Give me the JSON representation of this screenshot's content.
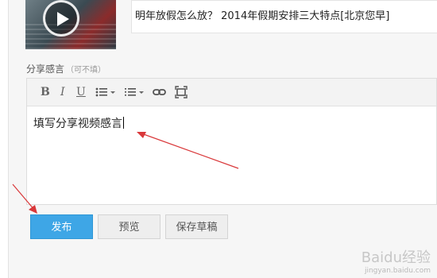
{
  "share": {
    "title": "明年放假怎么放？  2014年假期安排三大特点[北京您早]"
  },
  "comment": {
    "label": "分享感言",
    "optional_hint": "（可不填）",
    "toolbar": {
      "bold": "B",
      "italic": "I",
      "underline": "U"
    },
    "content": "填写分享视频感言"
  },
  "actions": {
    "publish": "发布",
    "preview": "预览",
    "save_draft": "保存草稿"
  },
  "watermark": {
    "brand": "Baidu经验",
    "url": "jingyan.baidu.com"
  },
  "colors": {
    "accent": "#3ea6e6",
    "annotation_arrow": "#d9383a"
  }
}
